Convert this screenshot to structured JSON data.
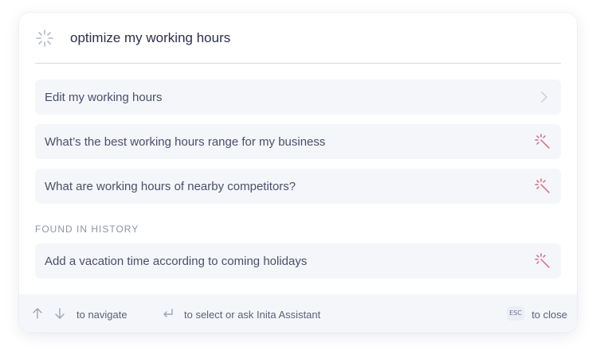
{
  "search": {
    "query": "optimize my working hours",
    "icon": "loading-spinner-icon"
  },
  "results": [
    {
      "label": "Edit my working hours",
      "icon": "chevron-right-icon"
    },
    {
      "label": "What’s the best working hours range for my business",
      "icon": "magic-wand-icon"
    },
    {
      "label": "What are working hours of nearby competitors?",
      "icon": "magic-wand-icon"
    }
  ],
  "history": {
    "heading": "FOUND IN HISTORY",
    "items": [
      {
        "label": "Add a vacation time according to coming holidays",
        "icon": "magic-wand-icon"
      }
    ]
  },
  "footer": {
    "navigate_label": "to navigate",
    "select_label": "to select or ask Inita Assistant",
    "esc_key": "ESC",
    "close_label": "to close"
  },
  "colors": {
    "accent": "#d4687a",
    "muted_icon": "#b9bccc",
    "row_bg": "#f5f6fa"
  }
}
